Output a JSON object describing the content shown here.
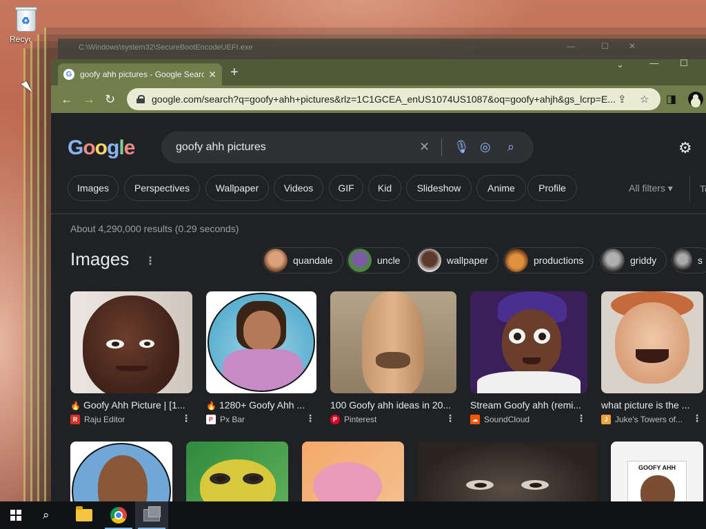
{
  "desktop": {
    "recycle_label": "Recycle Bin"
  },
  "console": {
    "title": "C:\\Windows\\system32\\SecureBootEncodeUEFI.exe"
  },
  "browser": {
    "tab_title": "goofy ahh pictures - Google Search",
    "address": "google.com/search?q=goofy+ahh+pictures&rlz=1C1GCEA_enUS1074US1087&oq=goofy+ahjh&gs_lcrp=E..."
  },
  "google": {
    "logo": "Google",
    "query": "goofy ahh pictures",
    "filters": [
      "Images",
      "Perspectives",
      "Wallpaper",
      "Videos",
      "GIF",
      "Kid",
      "Slideshow",
      "Anime",
      "Profile"
    ],
    "all_filters": "All filters",
    "tools": "To",
    "stats": "About 4,290,000 results (0.29 seconds)",
    "images_heading": "Images",
    "related": [
      "quandale",
      "uncle",
      "wallpaper",
      "productions",
      "griddy",
      "s"
    ],
    "results": [
      {
        "title": "Goofy Ahh Picture | [1...",
        "source": "Raju Editor",
        "trending": true,
        "source_color": "#d93025",
        "source_glyph": "R"
      },
      {
        "title": "1280+ Goofy Ahh ...",
        "source": "Px Bar",
        "trending": true,
        "source_color": "#ffffff",
        "source_glyph": "P"
      },
      {
        "title": "100 Goofy ahh ideas in 20...",
        "source": "Pinterest",
        "trending": false,
        "source_color": "#e60023",
        "source_glyph": "P"
      },
      {
        "title": "Stream Goofy ahh (remi...",
        "source": "SoundCloud",
        "trending": false,
        "source_color": "#ff5500",
        "source_glyph": "☁"
      },
      {
        "title": "what picture is the ...",
        "source": "Juke's Towers of...",
        "trending": false,
        "source_color": "#f1a33a",
        "source_glyph": "J"
      }
    ],
    "bottom_caption": "GOOFY AHH"
  },
  "colors": {
    "accent_blue": "#8ab4f8",
    "page_bg": "#202124",
    "tab_green": "#727d4c"
  }
}
